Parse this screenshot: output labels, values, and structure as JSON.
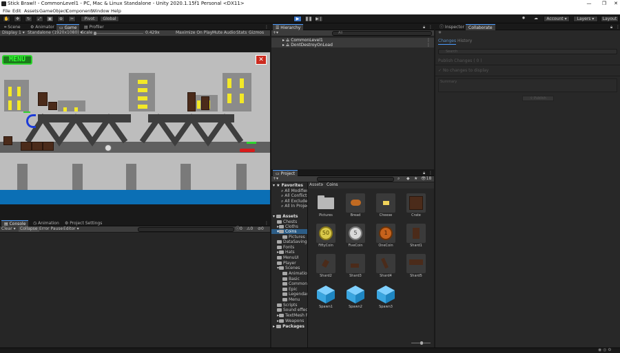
{
  "window": {
    "title": "Stick Brawl! - CommonLevel1 - PC, Mac & Linux Standalone - Unity 2020.1.15f1 Personal <DX11>"
  },
  "menu": [
    "File",
    "Edit",
    "Assets",
    "GameObject",
    "Component",
    "Window",
    "Help"
  ],
  "toolbar": {
    "pivot": "Pivot",
    "global": "Global",
    "account": "Account",
    "layers": "Layers",
    "layout": "Layout"
  },
  "game_tabs": [
    "Scene",
    "Animator",
    "Game",
    "Profiler"
  ],
  "game_bar": {
    "display": "Display 1",
    "resolution": "Standalone (1920x1080)",
    "scale_label": "Scale",
    "scale_value": "0.429x",
    "maximize": "Maximize On Play",
    "mute": "Mute Audio",
    "stats": "Stats",
    "gizmos": "Gizmos"
  },
  "game": {
    "menu_button": "MENU",
    "close_button": "✕"
  },
  "console": {
    "tabs": [
      "Console",
      "Animation",
      "Project Settings"
    ],
    "clear": "Clear",
    "collapse": "Collapse",
    "error_pause": "Error Pause",
    "editor": "Editor",
    "counts": [
      "0",
      "0",
      "0"
    ]
  },
  "hierarchy": {
    "tab": "Hierarchy",
    "search_placeholder": "All",
    "items": [
      "CommonLevel1",
      "DontDestroyOnLoad"
    ]
  },
  "inspector": {
    "tabs": [
      "Inspector",
      "Collaborate"
    ],
    "sub_tabs": [
      "Changes",
      "History"
    ],
    "search_placeholder": "Search",
    "publish_changes": "Publish Changes ( 0 )",
    "no_changes": "No changes to display",
    "summary_placeholder": "Summary",
    "publish_button": "Publish"
  },
  "project": {
    "tab": "Project",
    "hidden_count": "18",
    "favorites_label": "Favorites",
    "favorites": [
      "All Modified",
      "All Conflicts",
      "All Excluded",
      "All In Project"
    ],
    "assets_label": "Assets",
    "folders": [
      "Chests",
      "Cloths",
      "Coins",
      "Pictures",
      "DataSaving",
      "Fonts",
      "Hats",
      "MenuUI",
      "Player",
      "Scenes",
      "Animation",
      "Basic",
      "Common",
      "Epic",
      "Legendary",
      "Menu",
      "Scripts",
      "Sound effects",
      "TextMesh Pro",
      "Weapons"
    ],
    "packages_label": "Packages",
    "breadcrumb": [
      "Assets",
      "Coins"
    ],
    "assets": [
      "Pictures",
      "Bread",
      "Cheese",
      "Crate",
      "FiftyCoin",
      "FiveCoin",
      "OneCoin",
      "Shard1",
      "Shard2",
      "Shard3",
      "Shard4",
      "Shard5",
      "Spawn1",
      "Spawn2",
      "Spawn3"
    ],
    "coin_values": [
      "50",
      "5",
      "1"
    ]
  },
  "colors": {
    "accent": "#4a9cff",
    "sky": "#bdbdbd",
    "water": "#0b6fb5",
    "building": "#8b8b8b",
    "window": "#f3e827",
    "menu_green": "#2dd42d",
    "close_red": "#cc2b1f"
  }
}
